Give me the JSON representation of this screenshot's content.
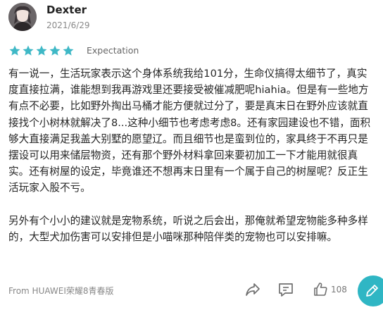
{
  "user": {
    "name": "Dexter",
    "date": "2021/6/29",
    "avatar_icon": "avatar-portrait"
  },
  "rating": {
    "stars": 5,
    "max": 5,
    "star_color": "#3fb8c6",
    "label": "Expectation"
  },
  "review": {
    "paragraph_1": "有一说一，生活玩家表示这个身体系统我给101分，生命仪搞得太细节了，真实度直接拉满，谁能想到我再游戏里还要接受被催减肥呢hiahia。但是有一些地方有点不必要，比如野外掏出马桶才能方便就过分了，要是真末日在野外应该就直接找个小树林就解决了8...这种小细节也考虑考虑8。还有家园建设也不错，面积够大直接满足我盖大别墅的愿望辽。而且细节也是蛮到位的，家具终于不再只是摆设可以用来储层物资，还有那个野外材料拿回来要初加工一下才能用就很真实。还有树屋的设定，毕竟谁还不想再末日里有一个属于自己的树屋呢？反正生活玩家入股不亏。",
    "paragraph_2": "另外有个小小的建议就是宠物系统，听说之后会出，那俺就希望宠物能多种多样的，大型犬加伤害可以安排但是小喵咪那种陪伴类的宠物也可以安排嘛。"
  },
  "footer": {
    "device": "From HUAWEI荣耀8青春版",
    "like_count": "108",
    "icons": [
      "share-icon",
      "comment-icon",
      "like-icon",
      "edit-icon"
    ],
    "accent_color": "#2fb6c4"
  }
}
